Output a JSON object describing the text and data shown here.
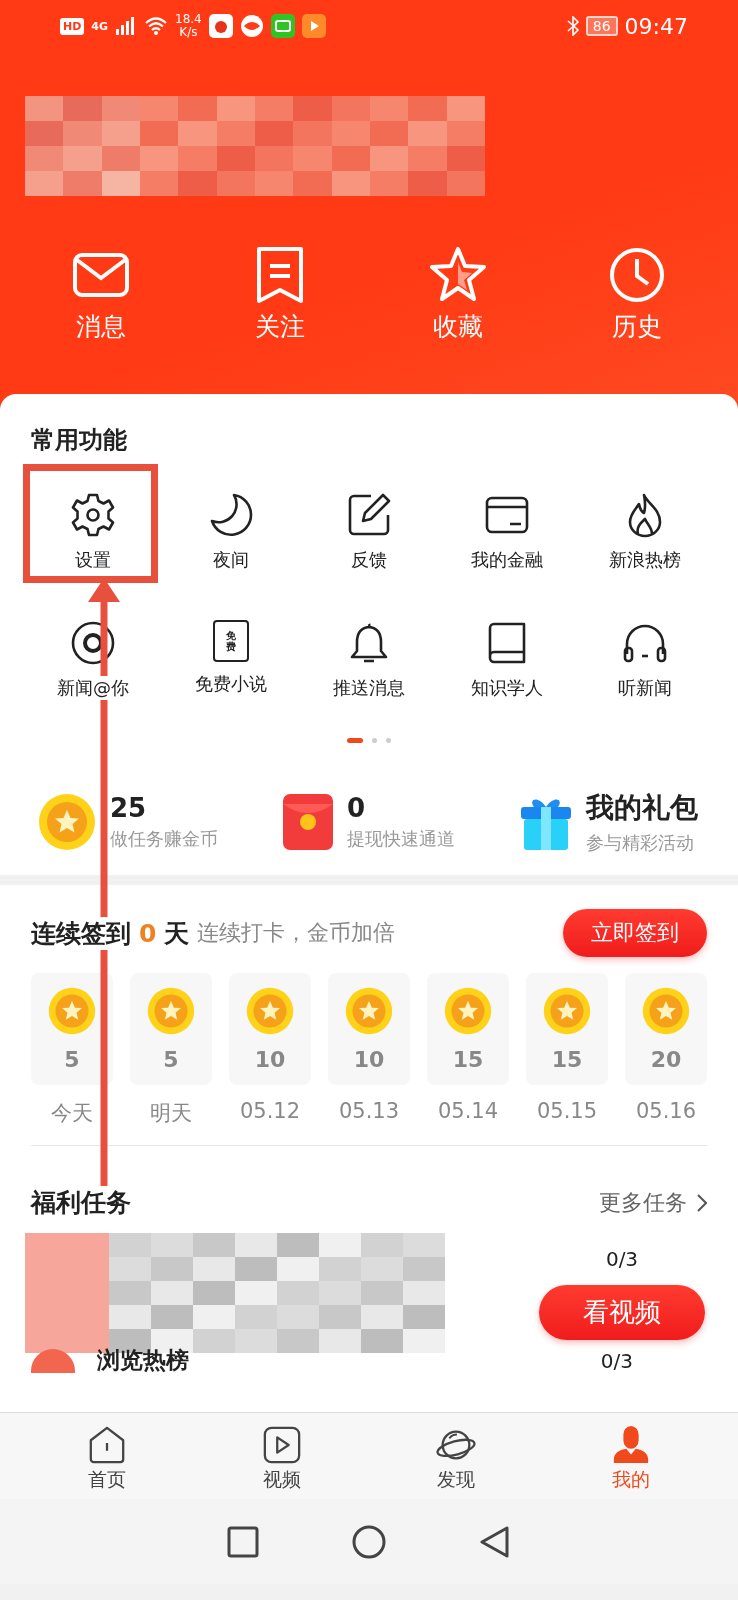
{
  "status_bar": {
    "hd": "HD",
    "network": "4G",
    "speed_value": "18.4",
    "speed_unit": "K/s",
    "battery": "86",
    "time": "09:47"
  },
  "quick_links": [
    {
      "label": "消息"
    },
    {
      "label": "关注"
    },
    {
      "label": "收藏"
    },
    {
      "label": "历史"
    }
  ],
  "features": {
    "title": "常用功能",
    "items": [
      {
        "label": "设置"
      },
      {
        "label": "夜间"
      },
      {
        "label": "反馈"
      },
      {
        "label": "我的金融"
      },
      {
        "label": "新浪热榜"
      },
      {
        "label": "新闻@你"
      },
      {
        "label": "免费小说",
        "icon_text": "免费"
      },
      {
        "label": "推送消息"
      },
      {
        "label": "知识学人"
      },
      {
        "label": "听新闻"
      }
    ],
    "page_dots": [
      {
        "selected": true
      },
      {
        "selected": false
      },
      {
        "selected": false
      }
    ]
  },
  "stats": [
    {
      "kind": "coin",
      "value": "25",
      "caption": "做任务赚金币"
    },
    {
      "kind": "envelope",
      "value": "0",
      "caption": "提现快速通道"
    },
    {
      "kind": "gift",
      "value": "我的礼包",
      "caption": "参与精彩活动"
    }
  ],
  "checkin": {
    "title": "连续签到",
    "count": "0",
    "unit": "天",
    "subtitle": "连续打卡，金币加倍",
    "button": "立即签到",
    "days": [
      {
        "coins": "5",
        "label": "今天"
      },
      {
        "coins": "5",
        "label": "明天"
      },
      {
        "coins": "10",
        "label": "05.12"
      },
      {
        "coins": "10",
        "label": "05.13"
      },
      {
        "coins": "15",
        "label": "05.14"
      },
      {
        "coins": "15",
        "label": "05.15"
      },
      {
        "coins": "20",
        "label": "05.16"
      }
    ]
  },
  "tasks": {
    "title": "福利任务",
    "more": "更多任务",
    "rows": [
      {
        "progress": "0/3",
        "button": "看视频"
      }
    ],
    "next_row": {
      "title": "浏览热榜",
      "progress": "0/3"
    }
  },
  "bottom_nav": [
    {
      "label": "首页",
      "selected": false
    },
    {
      "label": "视频",
      "selected": false
    },
    {
      "label": "发现",
      "selected": false
    },
    {
      "label": "我的",
      "selected": true
    }
  ]
}
